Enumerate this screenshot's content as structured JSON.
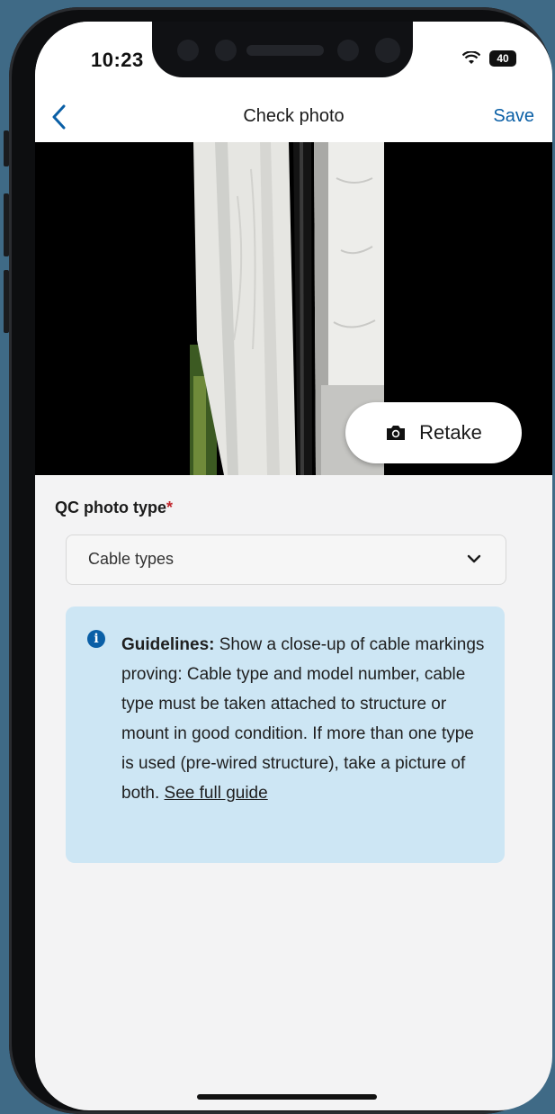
{
  "status_bar": {
    "time": "10:23",
    "battery": "40"
  },
  "nav": {
    "back_icon": "chevron-left-icon",
    "title": "Check photo",
    "save_label": "Save"
  },
  "photo": {
    "retake_label": "Retake",
    "retake_icon": "camera-icon"
  },
  "form": {
    "label": "QC photo type",
    "required_mark": "*",
    "selected_value": "Cable types"
  },
  "guidelines": {
    "heading": "Guidelines:",
    "body": "Show a close-up of cable markings proving: Cable type and model number, cable type must be taken attached to structure or mount in good condition. If more than one type is used (pre-wired structure), take a picture of both.",
    "link": "See full guide"
  },
  "colors": {
    "accent": "#0a5fa6",
    "guide_bg": "#cde6f4",
    "required": "#c0262d"
  }
}
